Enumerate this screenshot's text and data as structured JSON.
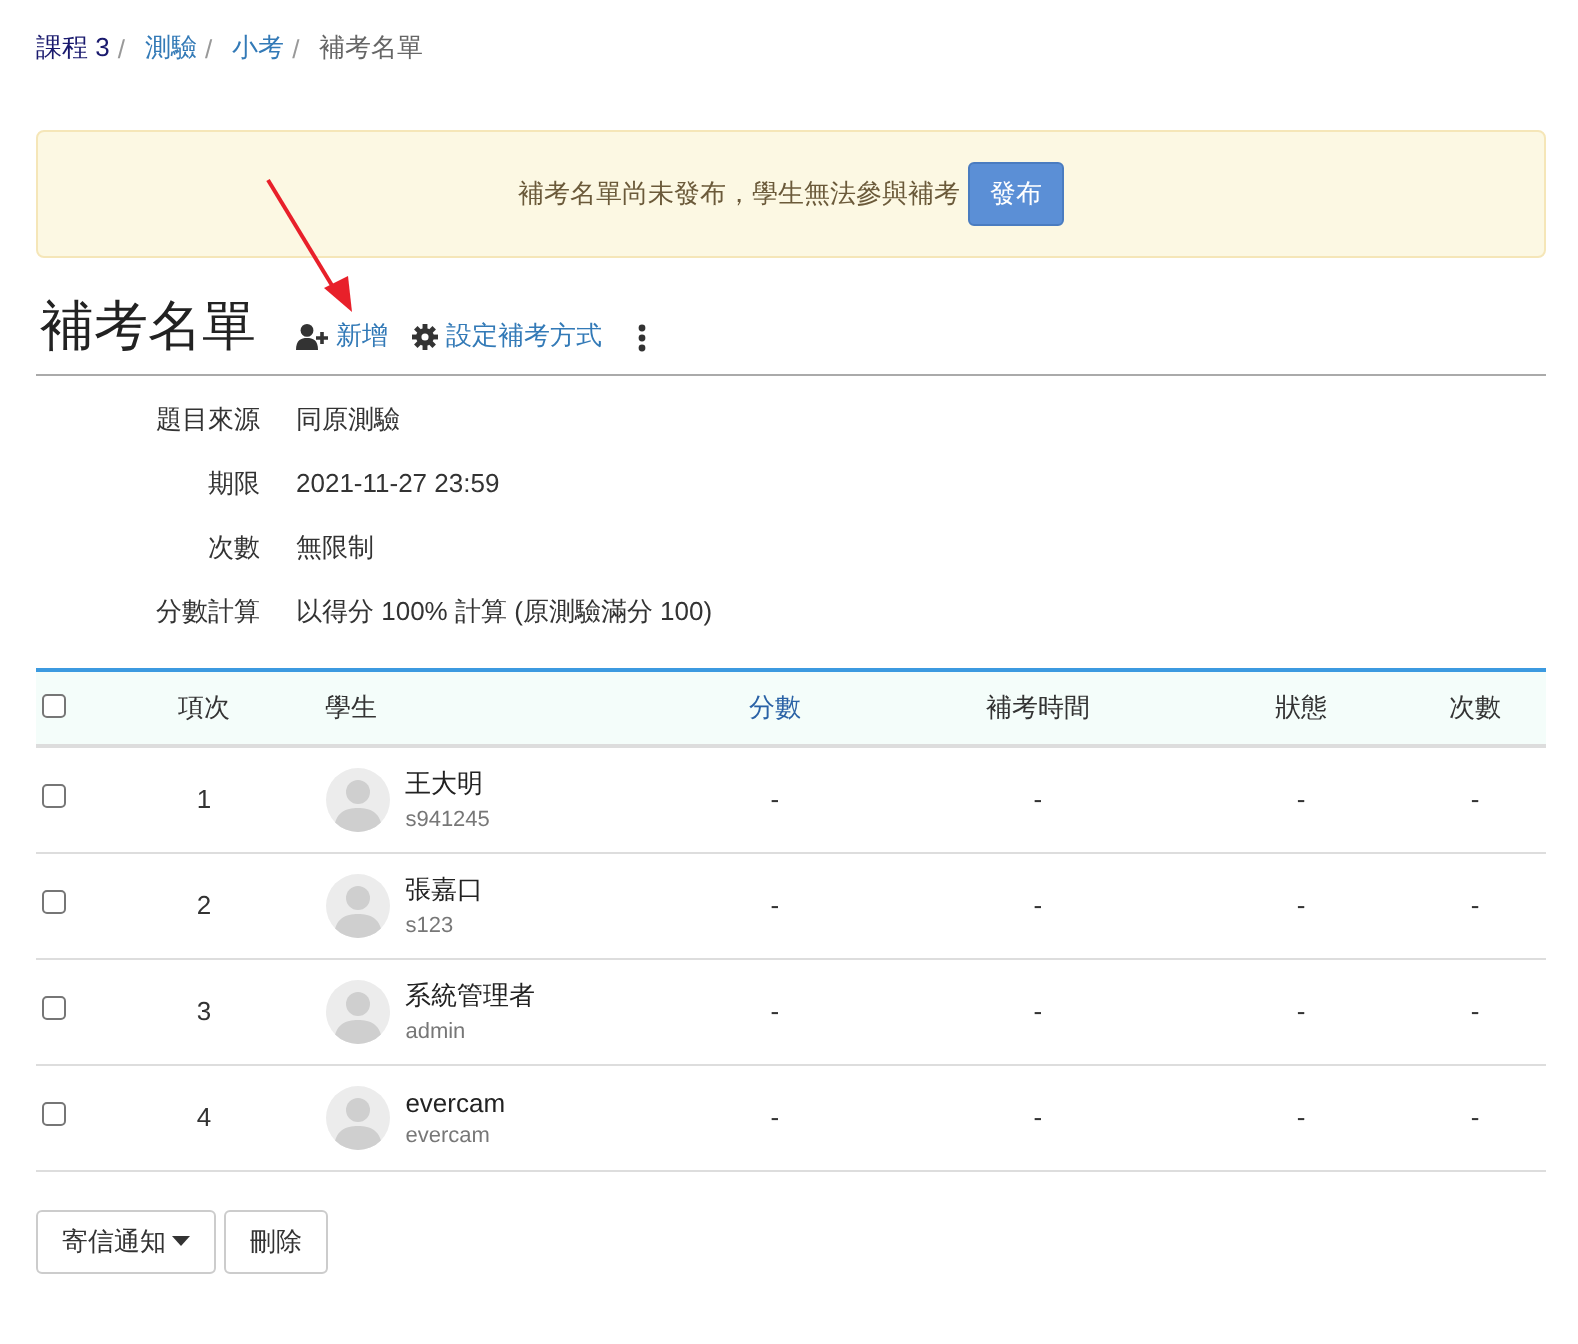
{
  "breadcrumb": [
    {
      "label": "課程 3"
    },
    {
      "label": "測驗"
    },
    {
      "label": "小考"
    },
    {
      "label": "補考名單"
    }
  ],
  "breadcrumb_separator": "/",
  "alert": {
    "message": "補考名單尚未發布，學生無法參與補考",
    "button": "發布"
  },
  "heading": {
    "title": "補考名單",
    "actions": [
      {
        "kind": "add",
        "label": "新增"
      },
      {
        "kind": "settings",
        "label": "設定補考方式"
      },
      {
        "kind": "more"
      }
    ]
  },
  "info": [
    {
      "label": "題目來源",
      "value": "同原測驗"
    },
    {
      "label": "期限",
      "value": "2021-11-27 23:59"
    },
    {
      "label": "次數",
      "value": "無限制"
    },
    {
      "label": "分數計算",
      "value": "以得分 100% 計算 (原測驗滿分 100)"
    }
  ],
  "table": {
    "select_all": {
      "checked": false
    },
    "columns": [
      {
        "label": "項次",
        "sortable": false
      },
      {
        "label": "學生",
        "sortable": false
      },
      {
        "label": "分數",
        "sortable": true
      },
      {
        "label": "補考時間",
        "sortable": false
      },
      {
        "label": "狀態",
        "sortable": false
      },
      {
        "label": "次數",
        "sortable": false
      }
    ],
    "rows": [
      {
        "checked": false,
        "index": "1",
        "name": "王大明",
        "account": "s941245",
        "score": "-",
        "time": "-",
        "status": "-",
        "count": "-"
      },
      {
        "checked": false,
        "index": "2",
        "name": "張嘉口",
        "account": "s123",
        "score": "-",
        "time": "-",
        "status": "-",
        "count": "-"
      },
      {
        "checked": false,
        "index": "3",
        "name": "系統管理者",
        "account": "admin",
        "score": "-",
        "time": "-",
        "status": "-",
        "count": "-"
      },
      {
        "checked": false,
        "index": "4",
        "name": "evercam",
        "account": "evercam",
        "score": "-",
        "time": "-",
        "status": "-",
        "count": "-"
      }
    ]
  },
  "footer_buttons": [
    {
      "kind": "dropdown",
      "label": "寄信通知"
    },
    {
      "kind": "plain",
      "label": "刪除"
    }
  ]
}
